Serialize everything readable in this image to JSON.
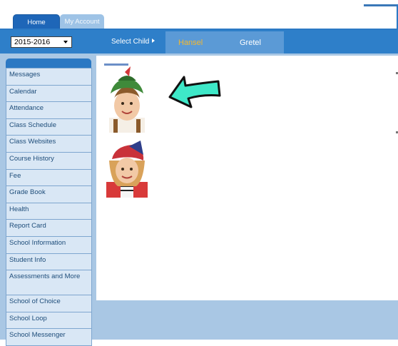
{
  "tabs": {
    "home": "Home",
    "account": "My Account"
  },
  "nav": {
    "year": "2015-2016",
    "select_child_label": "Select Child",
    "children": [
      "Hansel",
      "Gretel"
    ]
  },
  "sidebar": {
    "items": [
      {
        "label": "Messages"
      },
      {
        "label": "Calendar"
      },
      {
        "label": "Attendance"
      },
      {
        "label": "Class Schedule"
      },
      {
        "label": "Class Websites"
      },
      {
        "label": "Course History"
      },
      {
        "label": "Fee"
      },
      {
        "label": "Grade Book"
      },
      {
        "label": "Health"
      },
      {
        "label": "Report Card"
      },
      {
        "label": "School Information"
      },
      {
        "label": "Student Info"
      },
      {
        "label": "Assessments and More"
      },
      {
        "label": "School of Choice"
      },
      {
        "label": "School Loop"
      },
      {
        "label": "School Messenger"
      }
    ]
  },
  "colors": {
    "nav_blue": "#2e7fc9",
    "sidebar_bg": "#a9c7e4",
    "selected_child": "#f4b82e",
    "arrow_fill": "#3ee8c8"
  }
}
